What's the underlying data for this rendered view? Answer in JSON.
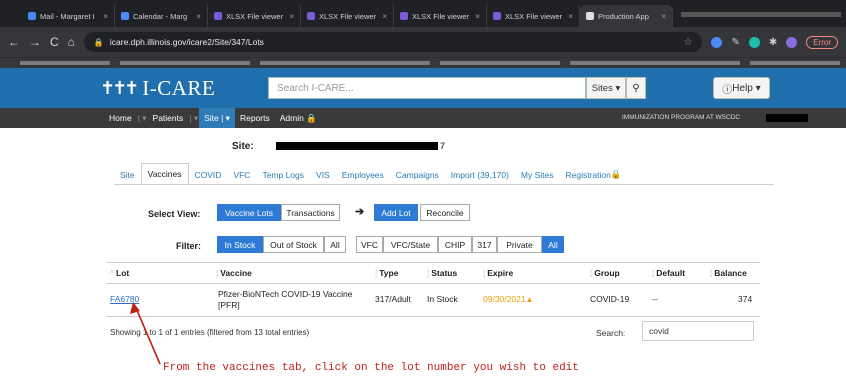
{
  "browser": {
    "tabs": [
      {
        "label": "Mail - Margaret I",
        "color": "#4a8af4",
        "active": false
      },
      {
        "label": "Calendar - Marg",
        "color": "#4a8af4",
        "active": false
      },
      {
        "label": "XLSX File viewer",
        "color": "#7b5bd6",
        "active": false
      },
      {
        "label": "XLSX File viewer",
        "color": "#7b5bd6",
        "active": false
      },
      {
        "label": "XLSX File viewer",
        "color": "#7b5bd6",
        "active": false
      },
      {
        "label": "XLSX File viewer",
        "color": "#7b5bd6",
        "active": false
      },
      {
        "label": "Production App",
        "color": "#dddddd",
        "active": true
      }
    ],
    "url": "icare.dph.illinois.gov/icare2/Site/347/Lots",
    "error_label": "Error"
  },
  "header": {
    "logo_text": "I-CARE",
    "search_placeholder": "Search I-CARE...",
    "sites_label": "Sites",
    "help_label": "Help"
  },
  "nav": {
    "items": [
      "Home",
      "Patients",
      "Site",
      "Reports",
      "Admin"
    ],
    "active": "Site",
    "program": "IMMUNIZATION PROGRAM AT WSCDC"
  },
  "site": {
    "label": "Site:",
    "tail": "7"
  },
  "subtabs": [
    "Site",
    "Vaccines",
    "COVID",
    "VFC",
    "Temp Logs",
    "VIS",
    "Employees",
    "Campaigns",
    "Import (39,170)",
    "My Sites",
    "Registration"
  ],
  "active_subtab": "Vaccines",
  "select_view": {
    "label": "Select View:",
    "vaccine_lots": "Vaccine Lots",
    "transactions": "Transactions",
    "add_lot": "Add Lot",
    "reconcile": "Reconcile"
  },
  "filter": {
    "label": "Filter:",
    "in_stock": "In Stock",
    "out_of_stock": "Out of Stock",
    "all1": "All",
    "vfc": "VFC",
    "vfc_state": "VFC/State",
    "chip": "CHIP",
    "n317": "317",
    "private": "Private",
    "all2": "All"
  },
  "table": {
    "headers": [
      "Lot",
      "Vaccine",
      "Type",
      "Status",
      "Expire",
      "Group",
      "Default",
      "Balance"
    ],
    "row": {
      "lot": "FA6780",
      "vaccine_line1": "Pfizer-BioNTech COVID-19 Vaccine",
      "vaccine_line2": "[PFR]",
      "type": "317/Adult",
      "status": "In Stock",
      "expire": "09/30/2021",
      "group": "COVID-19",
      "default": "--",
      "balance": "374"
    },
    "showing": "Showing 1 to 1 of 1 entries (filtered from 13 total entries)",
    "search_label": "Search:",
    "search_value": "covid"
  },
  "annotation": "From the vaccines tab, click on the lot number you wish to edit",
  "colors": {
    "brand_blue": "#1f6fad",
    "button_blue": "#2e7bd6",
    "annotation_red": "#c0211a",
    "expire_orange": "#e8a000"
  }
}
